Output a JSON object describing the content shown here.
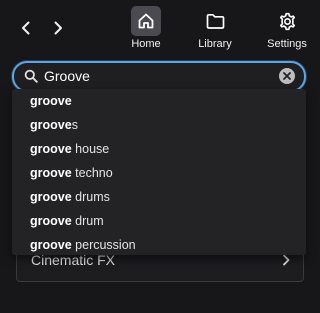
{
  "nav": {
    "back_icon": "chevron-left-icon",
    "forward_icon": "chevron-right-icon",
    "items": [
      {
        "label": "Home",
        "icon": "home-icon",
        "active": true
      },
      {
        "label": "Library",
        "icon": "folder-icon",
        "active": false
      },
      {
        "label": "Settings",
        "icon": "gear-icon",
        "active": false
      }
    ]
  },
  "search": {
    "value": "Groove",
    "icon": "search-icon",
    "clear_icon": "clear-icon",
    "accent": "#5aa6e6"
  },
  "suggestions": [
    {
      "match": "groove",
      "rest": ""
    },
    {
      "match": "groove",
      "rest": "s"
    },
    {
      "match": "groove",
      "rest": " house"
    },
    {
      "match": "groove",
      "rest": " techno"
    },
    {
      "match": "groove",
      "rest": " drums"
    },
    {
      "match": "groove",
      "rest": " drum"
    },
    {
      "match": "groove",
      "rest": " percussion"
    }
  ],
  "list": {
    "visible_row": "Cinematic FX"
  }
}
